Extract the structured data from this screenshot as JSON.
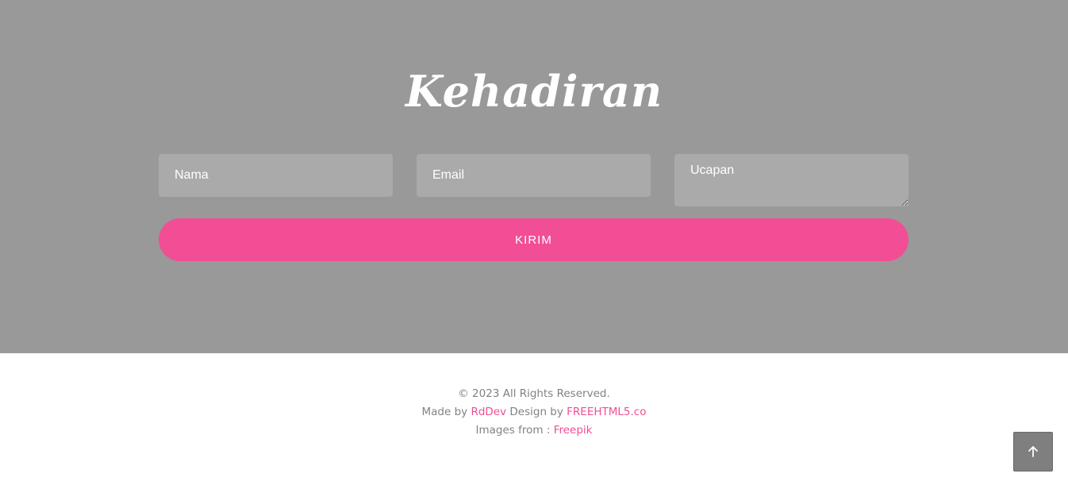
{
  "rsvp": {
    "title": "Kehadiran",
    "name_placeholder": "Nama",
    "email_placeholder": "Email",
    "message_placeholder": "Ucapan",
    "submit_label": "KIRIM"
  },
  "footer": {
    "copyright": "© 2023 All Rights Reserved.",
    "made_by_prefix": "Made by",
    "made_by_link": "RdDev",
    "design_by_prefix": "Design by",
    "design_by_link": "FREEHTML5.co",
    "images_prefix": "Images from :",
    "images_link": "Freepik"
  },
  "go_to_top": {
    "icon": "arrow-up-icon"
  },
  "colors": {
    "section_bg": "#999999",
    "field_bg": "#aaaaaa",
    "accent": "#f14e95",
    "footer_text": "#828282",
    "gototop_bg": "#7f7f7f"
  }
}
